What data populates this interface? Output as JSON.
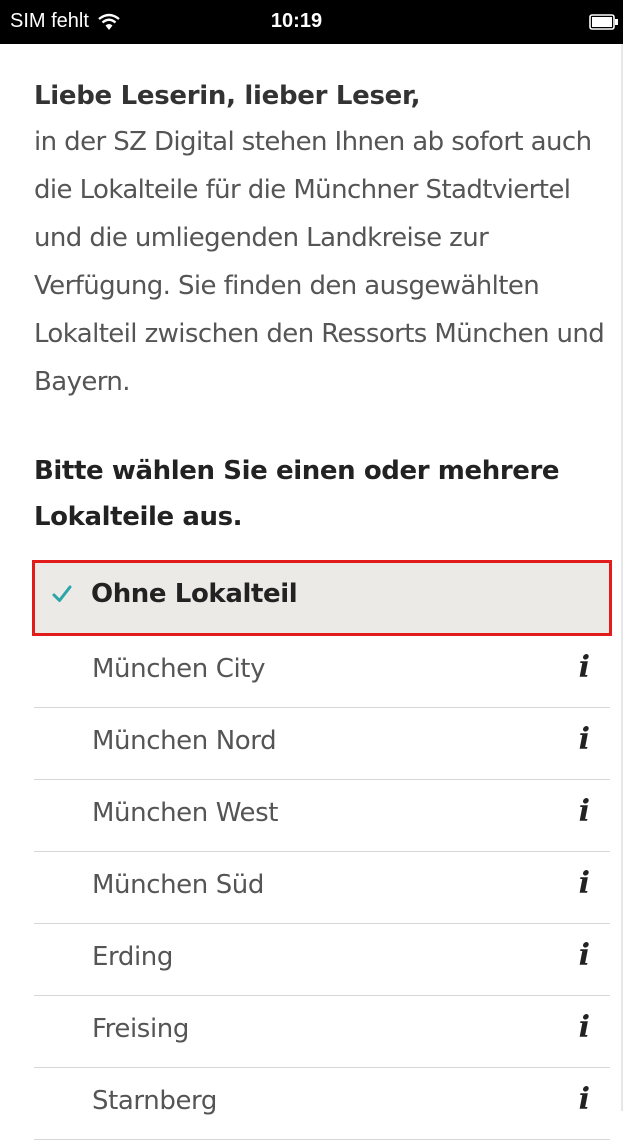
{
  "status_bar": {
    "carrier": "SIM fehlt",
    "time": "10:19",
    "wifi_icon": "wifi-icon",
    "battery_icon": "battery-icon"
  },
  "intro": {
    "greeting": "Liebe Leserin, lieber Leser,",
    "text": "in der SZ Digital stehen Ihnen ab sofort auch die Lokalteile für die Münchner Stadtviertel und die umliegenden Landkreise zur Verfügung. Sie finden den ausgewählten Lokalteil zwischen den Ressorts München und Bayern."
  },
  "prompt": "Bitte wählen Sie einen oder mehrere Lokalteile aus.",
  "options": [
    {
      "label": "Ohne Lokalteil",
      "selected": true
    },
    {
      "label": "München City",
      "selected": false
    },
    {
      "label": "München Nord",
      "selected": false
    },
    {
      "label": "München West",
      "selected": false
    },
    {
      "label": "München Süd",
      "selected": false
    },
    {
      "label": "Erding",
      "selected": false
    },
    {
      "label": "Freising",
      "selected": false
    },
    {
      "label": "Starnberg",
      "selected": false
    }
  ],
  "info_symbol": "i",
  "colors": {
    "checkmark": "#2aa5a8",
    "selection_border": "#e21b1b",
    "selection_background": "#ebeae6"
  }
}
